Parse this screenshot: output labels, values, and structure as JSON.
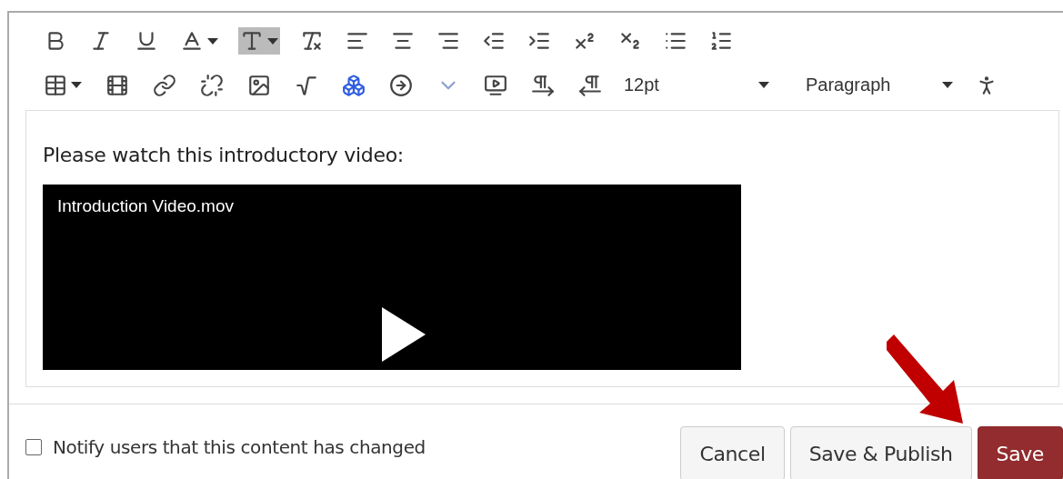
{
  "toolbar": {
    "font_size": "12pt",
    "block_format": "Paragraph"
  },
  "content": {
    "paragraph": "Please watch this introductory video:",
    "video": {
      "title": "Introduction Video.mov"
    }
  },
  "footer": {
    "notify": {
      "label": "Notify users that this content has changed",
      "checked": false
    },
    "buttons": [
      {
        "label": "Cancel",
        "kind": "default"
      },
      {
        "label": "Save & Publish",
        "kind": "default"
      },
      {
        "label": "Save",
        "kind": "primary"
      }
    ]
  }
}
